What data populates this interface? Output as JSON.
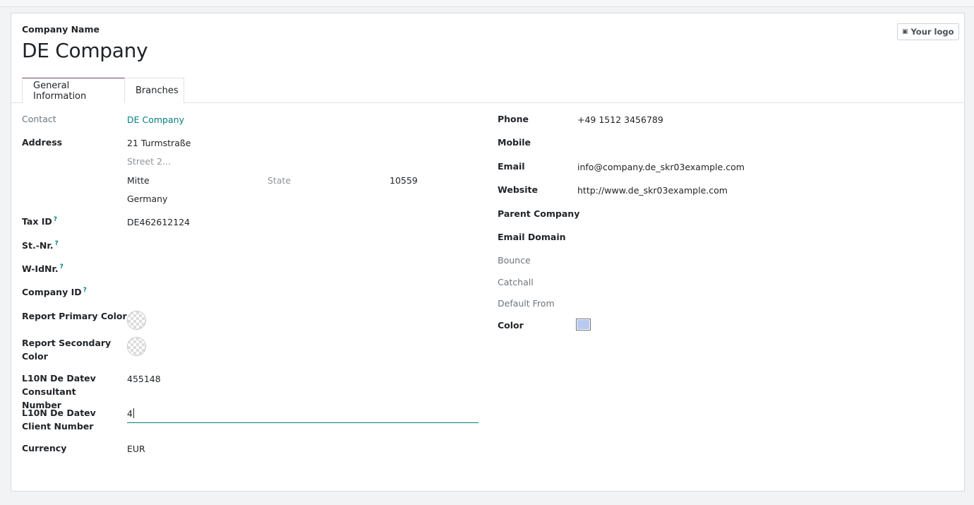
{
  "header": {
    "company_name_label": "Company Name",
    "company_name": "DE Company",
    "logo_button": "Your logo"
  },
  "tabs": [
    {
      "label": "General Information",
      "active": true
    },
    {
      "label": "Branches",
      "active": false
    }
  ],
  "left": {
    "contact": {
      "label": "Contact",
      "value": "DE Company"
    },
    "address": {
      "label": "Address",
      "street": "21 Turmstraße",
      "street2_placeholder": "Street 2...",
      "city": "Mitte",
      "state_placeholder": "State",
      "zip": "10559",
      "country": "Germany"
    },
    "tax_id": {
      "label": "Tax ID",
      "help": "?",
      "value": "DE462612124"
    },
    "st_nr": {
      "label": "St.-Nr.",
      "help": "?",
      "value": ""
    },
    "w_idnr": {
      "label": "W-IdNr.",
      "help": "?",
      "value": ""
    },
    "company_id": {
      "label": "Company ID",
      "help": "?",
      "value": ""
    },
    "report_primary_color": {
      "label": "Report Primary Color"
    },
    "report_secondary_color": {
      "label": "Report Secondary Color"
    },
    "consultant_number": {
      "label": "L10N De Datev Consultant Number",
      "value": "455148"
    },
    "client_number": {
      "label": "L10N De Datev Client Number",
      "value": "4"
    },
    "currency": {
      "label": "Currency",
      "value": "EUR"
    }
  },
  "right": {
    "phone": {
      "label": "Phone",
      "value": "+49 1512 3456789"
    },
    "mobile": {
      "label": "Mobile",
      "value": ""
    },
    "email": {
      "label": "Email",
      "value": "info@company.de_skr03example.com"
    },
    "website": {
      "label": "Website",
      "value": "http://www.de_skr03example.com"
    },
    "parent_company": {
      "label": "Parent Company",
      "value": ""
    },
    "email_domain": {
      "label": "Email Domain",
      "value": ""
    },
    "bounce": {
      "label": "Bounce",
      "value": ""
    },
    "catchall": {
      "label": "Catchall",
      "value": ""
    },
    "default_from": {
      "label": "Default From",
      "value": ""
    },
    "color": {
      "label": "Color",
      "value_hex": "#b7c9ef"
    }
  },
  "colors": {
    "accent": "#017e84",
    "tab_active_border": "#714b67"
  }
}
